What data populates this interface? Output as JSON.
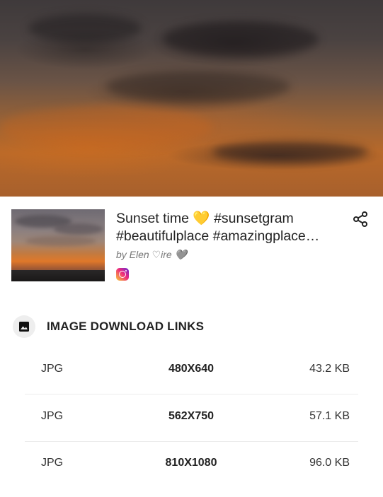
{
  "post": {
    "title": "Sunset time 💛 #sunsetgram\n#beautifulplace #amazingplace…",
    "author": "by Elen ♡ire 🩶",
    "source_icon": "instagram-icon"
  },
  "actions": {
    "share_icon": "share-icon"
  },
  "downloads": {
    "section_title": "IMAGE DOWNLOAD LINKS",
    "section_icon": "image-icon",
    "rows": [
      {
        "format": "JPG",
        "resolution": "480X640",
        "size": "43.2 KB"
      },
      {
        "format": "JPG",
        "resolution": "562X750",
        "size": "57.1 KB"
      },
      {
        "format": "JPG",
        "resolution": "810X1080",
        "size": "96.0 KB"
      }
    ]
  }
}
